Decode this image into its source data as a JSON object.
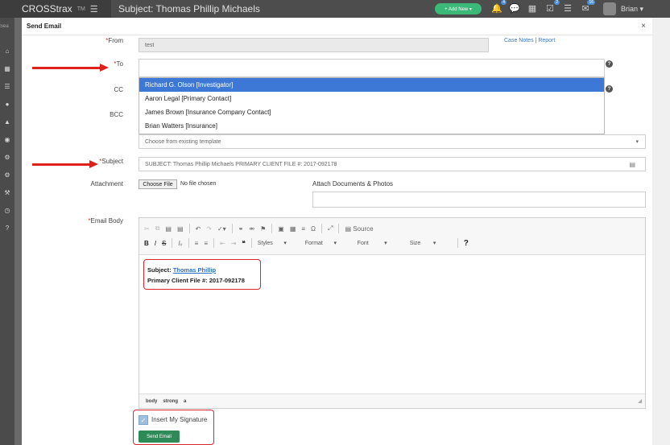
{
  "app": {
    "brand": "CROSStrax",
    "brand_tm": "TM",
    "subject": "Subject: Thomas Phillip Michaels"
  },
  "topbar": {
    "add_new": "+ Add New ▾",
    "user": "Brian ▾",
    "badges": {
      "notifications": "4",
      "calendar": "2",
      "messages": "16"
    },
    "icons": [
      "bell-icon",
      "chat-icon",
      "calendar-icon",
      "checklist-icon",
      "tasks-icon",
      "mail-icon"
    ]
  },
  "sidebar": {
    "search_stub": "Sea",
    "icons": [
      "home-icon",
      "grid-icon",
      "list-icon",
      "user-icon",
      "person-icon",
      "users-icon",
      "gear-icon",
      "gears-icon",
      "tools-icon",
      "clock-icon",
      "help-icon"
    ]
  },
  "modal": {
    "title": "Send Email",
    "close": "×",
    "from_label": "From",
    "from_value": "test",
    "case_notes_link": "Case Notes",
    "link_sep": "|",
    "report_link": "Report",
    "to_label": "To",
    "cc_label": "CC",
    "bcc_label": "BCC",
    "dropdown_items": [
      "Richard G. Olson [Investigator]",
      "Aaron Legal [Primary Contact]",
      "James Brown [Insurance Company Contact]",
      "Brian Watters [Insurance]"
    ],
    "template_placeholder": "Choose from existing template",
    "template_caret": "▾",
    "subject_label": "Subject",
    "subject_value": "SUBJECT: Thomas Phillip Michaels PRIMARY CLIENT FILE #: 2017-092178",
    "attachment_label": "Attachment",
    "choose_file": "Choose File",
    "no_file": "No file chosen",
    "attach_docs_label": "Attach Documents & Photos",
    "email_body_label": "Email Body",
    "editor": {
      "source_label": "Source",
      "styles_label": "Styles",
      "format_label": "Format",
      "font_label": "Font",
      "size_label": "Size",
      "body_line1_prefix": "Subject:",
      "body_line1_link": "Thomas Phillip",
      "body_line2": "Primary Client File #: 2017-092178",
      "status_path": [
        "body",
        "strong",
        "a"
      ]
    },
    "insert_signature": "Insert My Signature",
    "send_button": "Send Email"
  },
  "colors": {
    "accent_red": "#e0201b",
    "send_green": "#2e8b57",
    "selection_blue": "#3d78d6",
    "add_new_green": "#3cb878"
  }
}
